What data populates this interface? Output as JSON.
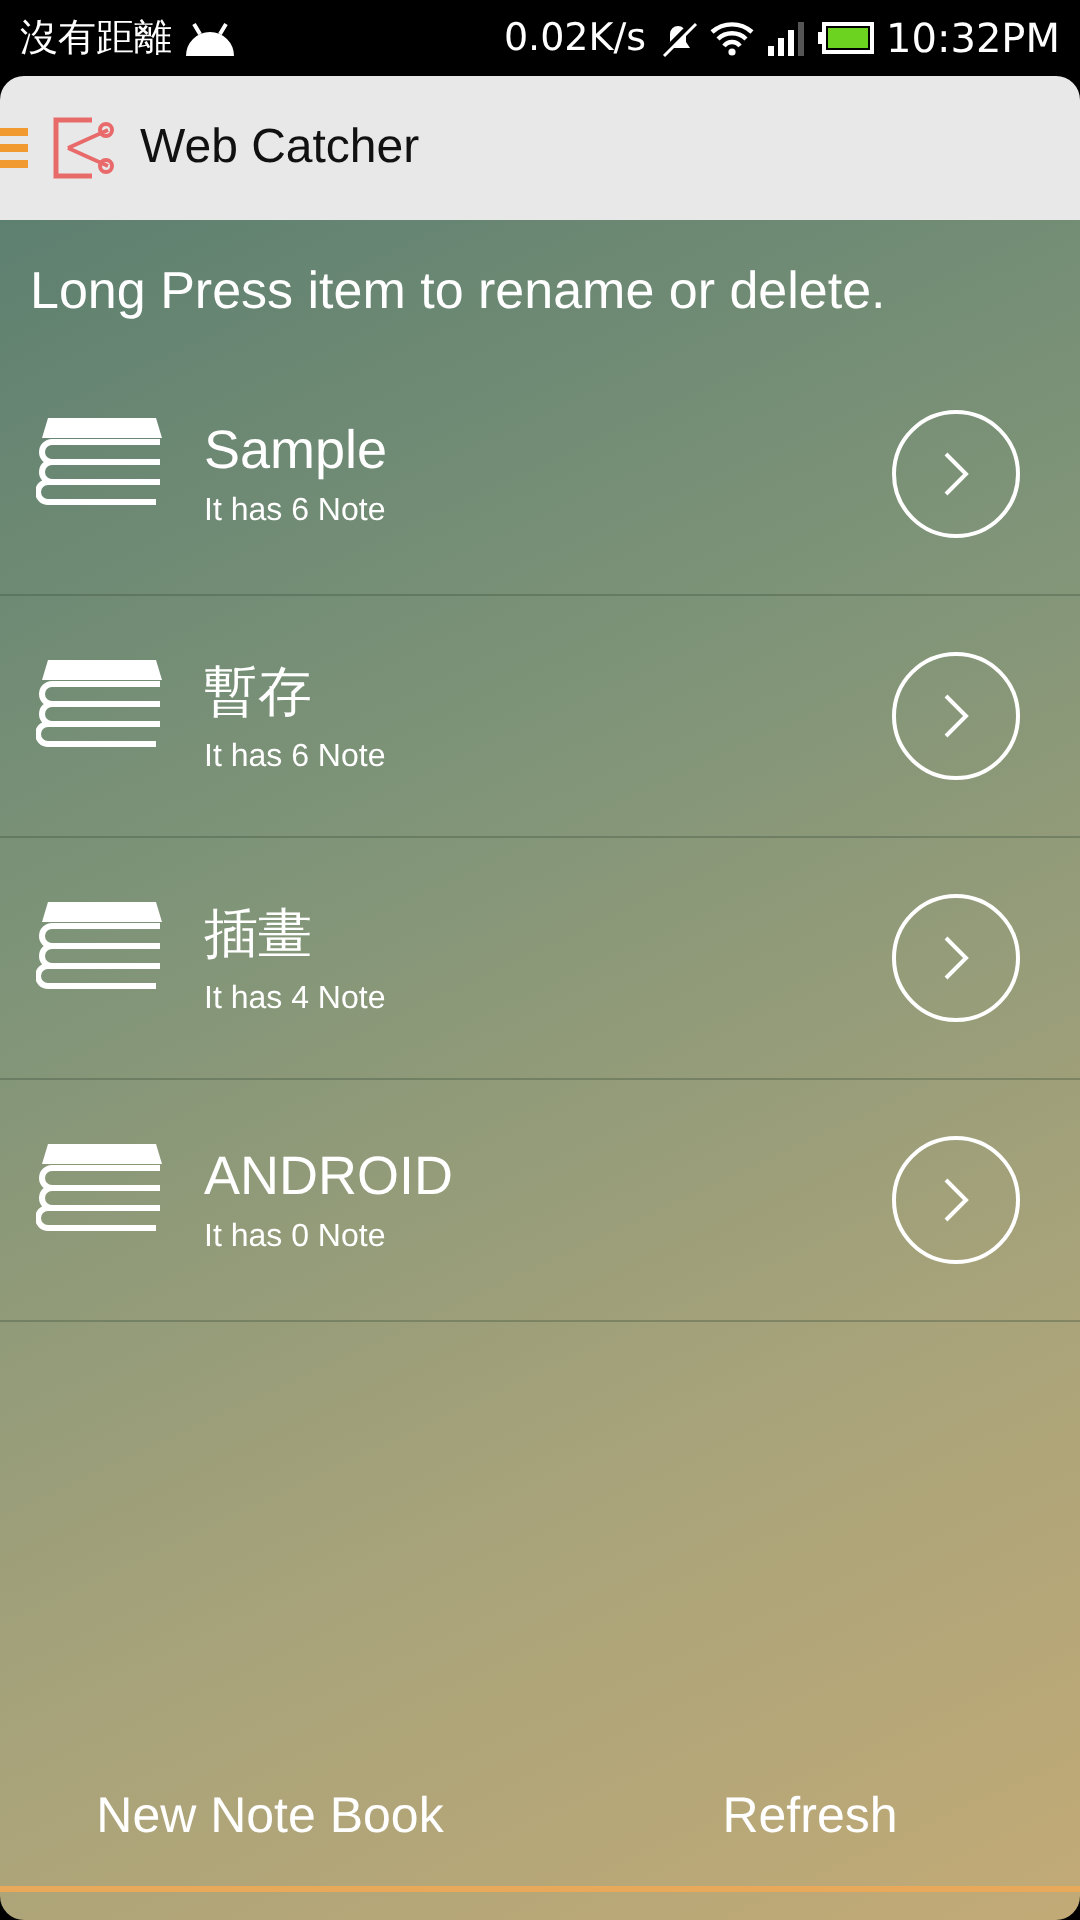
{
  "status_bar": {
    "carrier": "沒有距離",
    "speed": "0.02K/s",
    "time": "10:32PM"
  },
  "app_bar": {
    "title": "Web Catcher"
  },
  "hint": "Long Press item to rename or delete.",
  "notebooks": [
    {
      "name": "Sample",
      "count": "It has 6 Note"
    },
    {
      "name": "暫存",
      "count": "It has 6 Note"
    },
    {
      "name": "插畫",
      "count": "It has 4 Note"
    },
    {
      "name": "ANDROID",
      "count": "It has 0 Note"
    }
  ],
  "footer": {
    "buttons": [
      "New Note Book",
      "Refresh"
    ]
  }
}
